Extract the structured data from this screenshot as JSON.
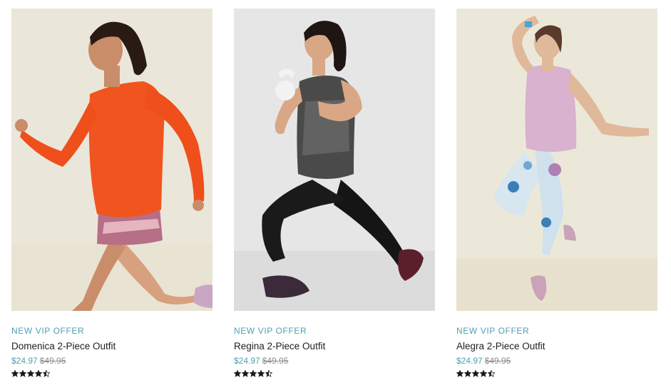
{
  "products": [
    {
      "badge": "NEW VIP OFFER",
      "name": "Domenica 2-Piece Outfit",
      "sale_price": "$24.97",
      "original_price": "$49.95",
      "rating": 4.5,
      "photo_bg": "#ebe6da"
    },
    {
      "badge": "NEW VIP OFFER",
      "name": "Regina 2-Piece Outfit",
      "sale_price": "$24.97",
      "original_price": "$49.95",
      "rating": 4.5,
      "photo_bg": "#e6e6e6"
    },
    {
      "badge": "NEW VIP OFFER",
      "name": "Alegra 2-Piece Outfit",
      "sale_price": "$24.97",
      "original_price": "$49.95",
      "rating": 4.5,
      "photo_bg": "#ece8d9"
    }
  ],
  "colors": {
    "accent": "#4f9fb1",
    "text": "#1e1e1e",
    "muted": "#8c8c8c",
    "star": "#1a1a1a"
  }
}
